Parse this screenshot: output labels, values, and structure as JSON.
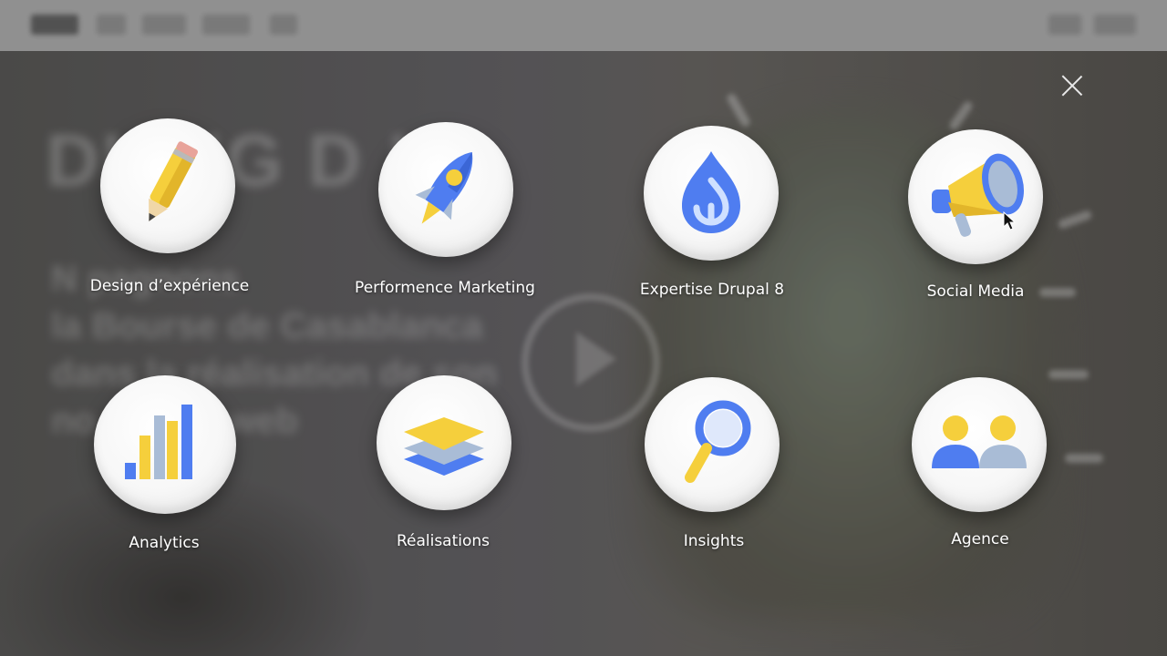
{
  "menu": {
    "items": [
      {
        "label": "Design d’expérience",
        "icon": "pencil-icon"
      },
      {
        "label": "Performence Marketing",
        "icon": "rocket-icon"
      },
      {
        "label": "Expertise Drupal 8",
        "icon": "drupal-drop-icon"
      },
      {
        "label": "Social Media",
        "icon": "megaphone-icon"
      },
      {
        "label": "Analytics",
        "icon": "bar-chart-icon"
      },
      {
        "label": "Réalisations",
        "icon": "layers-icon"
      },
      {
        "label": "Insights",
        "icon": "magnifier-icon"
      },
      {
        "label": "Agence",
        "icon": "users-icon"
      }
    ],
    "close_icon": "close-icon"
  },
  "colors": {
    "blue": "#4f7df0",
    "yellow": "#f5cf3c",
    "grey_blue": "#a9bcd6"
  }
}
